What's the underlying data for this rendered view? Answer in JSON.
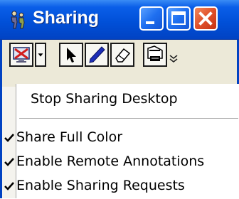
{
  "window": {
    "title": "Sharing"
  },
  "menu": {
    "items": [
      {
        "label": "Stop Sharing Desktop",
        "checked": false
      },
      {
        "label": "Share Full Color",
        "checked": true
      },
      {
        "label": "Enable Remote Annotations",
        "checked": true
      },
      {
        "label": "Enable Sharing Requests",
        "checked": true
      }
    ]
  },
  "colors": {
    "titlebar": "#0150d8",
    "close_button": "#e0502a",
    "toolbar_bg": "#ece9d8"
  },
  "icons": [
    "app-person-icon",
    "minimize-icon",
    "maximize-icon",
    "close-icon",
    "share-desktop-icon",
    "dropdown-arrow-icon",
    "pointer-arrow-icon",
    "pen-icon",
    "eraser-icon",
    "annotation-tool-icon",
    "overflow-chevron-icon",
    "checkmark-icon"
  ]
}
